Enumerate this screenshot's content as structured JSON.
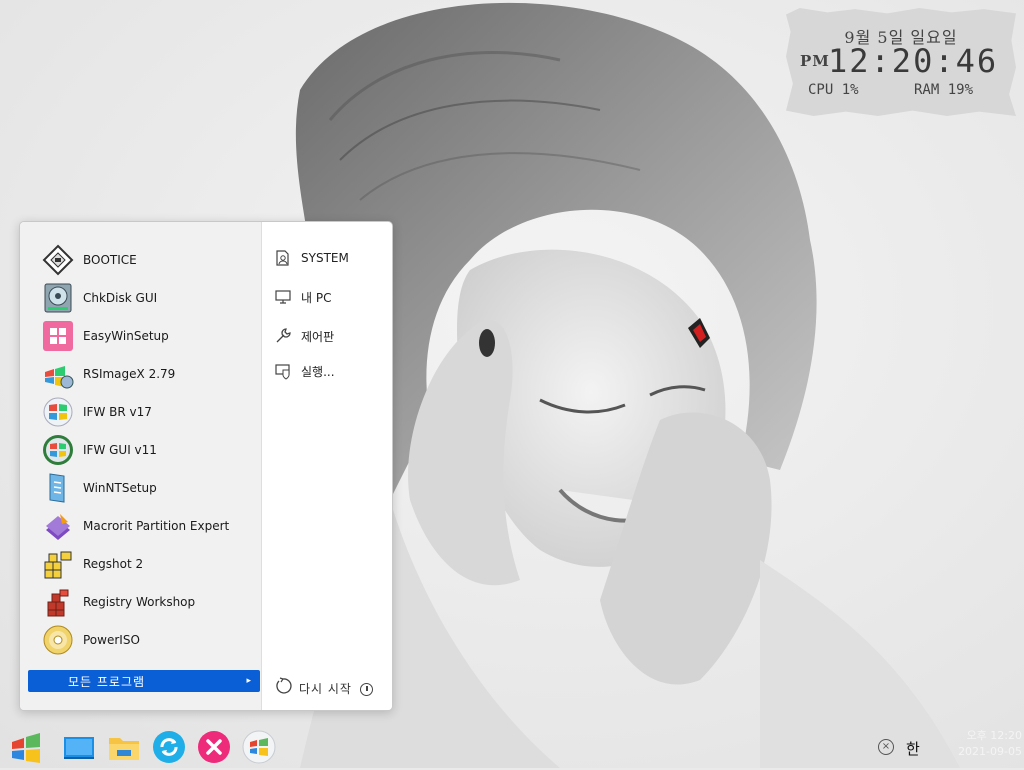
{
  "clock_gadget": {
    "date": "9월 5일 일요일",
    "ampm": "PM",
    "time": "12:20:46",
    "cpu": "CPU 1%",
    "ram": "RAM 19%"
  },
  "start_menu": {
    "programs": [
      {
        "label": "BOOTICE",
        "icon": "bootice-icon"
      },
      {
        "label": "ChkDisk GUI",
        "icon": "chkdisk-icon"
      },
      {
        "label": "EasyWinSetup",
        "icon": "easywinsetup-icon"
      },
      {
        "label": "RSImageX 2.79",
        "icon": "rsimagex-icon"
      },
      {
        "label": "IFW BR v17",
        "icon": "ifw-br-icon"
      },
      {
        "label": "IFW GUI v11",
        "icon": "ifw-gui-icon"
      },
      {
        "label": "WinNTSetup",
        "icon": "winntsetup-icon"
      },
      {
        "label": "Macrorit Partition Expert",
        "icon": "macrorit-icon"
      },
      {
        "label": "Regshot 2",
        "icon": "regshot-icon"
      },
      {
        "label": "Registry Workshop",
        "icon": "registry-workshop-icon"
      },
      {
        "label": "PowerISO",
        "icon": "poweriso-icon"
      }
    ],
    "all_programs_label": "모든 프로그램",
    "places": [
      {
        "label": "SYSTEM",
        "icon": "user-folder-icon"
      },
      {
        "label": "내 PC",
        "icon": "computer-icon"
      },
      {
        "label": "제어판",
        "icon": "wrench-icon"
      },
      {
        "label": "실행...",
        "icon": "run-icon"
      }
    ],
    "restart_label": "다시 시작"
  },
  "taskbar": {
    "buttons": [
      "start-orb-icon",
      "desktop-icon",
      "file-explorer-icon",
      "refresh-icon",
      "close-icon",
      "windows-icon"
    ],
    "tray": {
      "ime": "한",
      "time": "오후 12:20",
      "date": "2021-09-05"
    }
  }
}
